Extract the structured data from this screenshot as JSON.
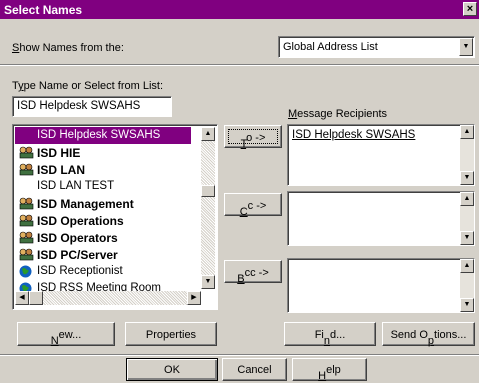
{
  "window": {
    "title": "Select Names",
    "close_glyph": "×"
  },
  "show_names": {
    "label": "Show Names from the:",
    "label_key": "S",
    "selected": "Global Address List"
  },
  "type_name": {
    "label": "Type Name or Select from List:",
    "label_key": "y",
    "value": "ISD Helpdesk SWSAHS"
  },
  "list": [
    {
      "label": "ISD Helpdesk SWSAHS",
      "icon": "none",
      "bold": false,
      "selected": true
    },
    {
      "label": "ISD HIE",
      "icon": "distribution-list-icon",
      "bold": true
    },
    {
      "label": "ISD LAN",
      "icon": "distribution-list-icon",
      "bold": true
    },
    {
      "label": "ISD LAN TEST",
      "icon": "none",
      "bold": false
    },
    {
      "label": "ISD Management",
      "icon": "distribution-list-icon",
      "bold": true
    },
    {
      "label": "ISD Operations",
      "icon": "distribution-list-icon",
      "bold": true
    },
    {
      "label": "ISD Operators",
      "icon": "distribution-list-icon",
      "bold": true
    },
    {
      "label": "ISD PC/Server",
      "icon": "distribution-list-icon",
      "bold": true
    },
    {
      "label": "ISD Receptionist",
      "icon": "globe-icon",
      "bold": false
    },
    {
      "label": "ISD RSS Meeting Room",
      "icon": "globe-icon",
      "bold": false
    }
  ],
  "recipients": {
    "label": "Message Recipients",
    "label_key": "M",
    "to_button": "To ->",
    "cc_button": "Cc ->",
    "bcc_button": "Bcc ->",
    "to_value": "ISD Helpdesk SWSAHS"
  },
  "buttons": {
    "new": "New...",
    "properties": "Properties",
    "find": "Find...",
    "send_options": "Send Options...",
    "ok": "OK",
    "cancel": "Cancel",
    "help": "Help"
  },
  "colors": {
    "title_bar": "#800080",
    "selection": "#800080",
    "face": "#d4d0c8"
  }
}
